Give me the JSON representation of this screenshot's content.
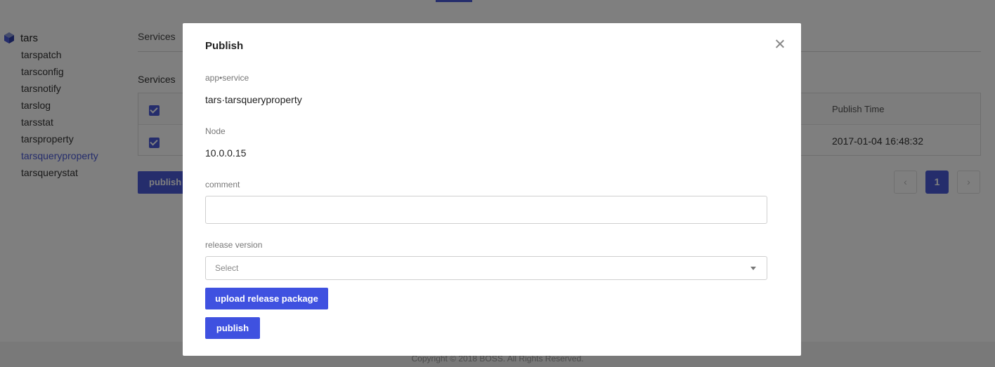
{
  "sidebar": {
    "root_label": "tars",
    "items": [
      {
        "label": "tarspatch"
      },
      {
        "label": "tarsconfig"
      },
      {
        "label": "tarsnotify"
      },
      {
        "label": "tarslog"
      },
      {
        "label": "tarsstat"
      },
      {
        "label": "tarsproperty"
      },
      {
        "label": "tarsqueryproperty",
        "active": true
      },
      {
        "label": "tarsquerystat"
      }
    ]
  },
  "main": {
    "tab_label": "Services",
    "section_title": "Services",
    "table": {
      "columns": [
        "",
        "Publish Time"
      ],
      "rows": [
        {
          "checked": true,
          "publish_time": "2017-01-04 16:48:32"
        }
      ]
    },
    "publish_button_label": "publish",
    "pagination": {
      "current_page": "1",
      "prev_icon": "‹",
      "next_icon": "›"
    }
  },
  "footer": {
    "copyright": "Copyright © 2018 BOSS. All Rights Reserved."
  },
  "modal": {
    "title": "Publish",
    "app_service_label": "app•service",
    "app_service_value": "tars·tarsqueryproperty",
    "node_label": "Node",
    "node_value": "10.0.0.15",
    "comment_label": "comment",
    "comment_value": "",
    "release_version_label": "release version",
    "release_version_placeholder": "Select",
    "upload_button_label": "upload release package",
    "publish_button_label": "publish"
  },
  "colors": {
    "accent": "#4a5bd8",
    "modal_button": "#3f51e0",
    "mask": "rgba(0,0,0,0.5)"
  },
  "icons": {
    "tree_root": "cube-icon",
    "close": "close-icon",
    "select_arrow": "caret-down-icon"
  }
}
